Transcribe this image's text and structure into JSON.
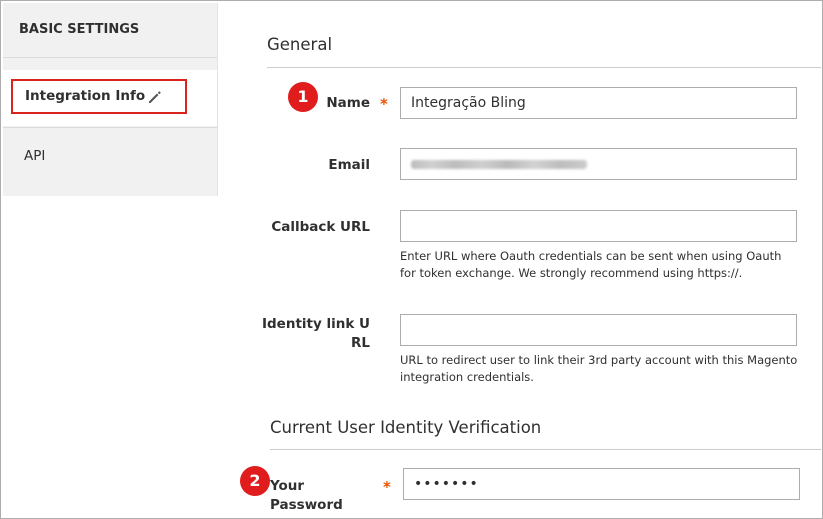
{
  "sidebar": {
    "title": "BASIC SETTINGS",
    "items": [
      {
        "label": "Integration Info",
        "active": true,
        "icon": "pencil-icon"
      },
      {
        "label": "API",
        "active": false
      }
    ]
  },
  "general": {
    "title": "General",
    "name": {
      "label": "Name",
      "required_mark": "*",
      "value": "Integração Bling",
      "badge": "1"
    },
    "email": {
      "label": "Email",
      "value_obscured": true
    },
    "callback_url": {
      "label": "Callback URL",
      "value": "",
      "note": "Enter URL where Oauth credentials can be sent when using Oauth for token exchange. We strongly recommend using https://."
    },
    "identity_link_url": {
      "label_line1": "Identity link U",
      "label_line2": "RL",
      "value": "",
      "note": "URL to redirect user to link their 3rd party account with this Magento integration credentials."
    }
  },
  "verification": {
    "title": "Current User Identity Verification",
    "password": {
      "label": "Your Password",
      "required_mark": "*",
      "value": "•••••••",
      "badge": "2"
    }
  },
  "colors": {
    "accent_red": "#e11c1c",
    "required_orange": "#eb5202",
    "active_border": "#d9241c"
  }
}
